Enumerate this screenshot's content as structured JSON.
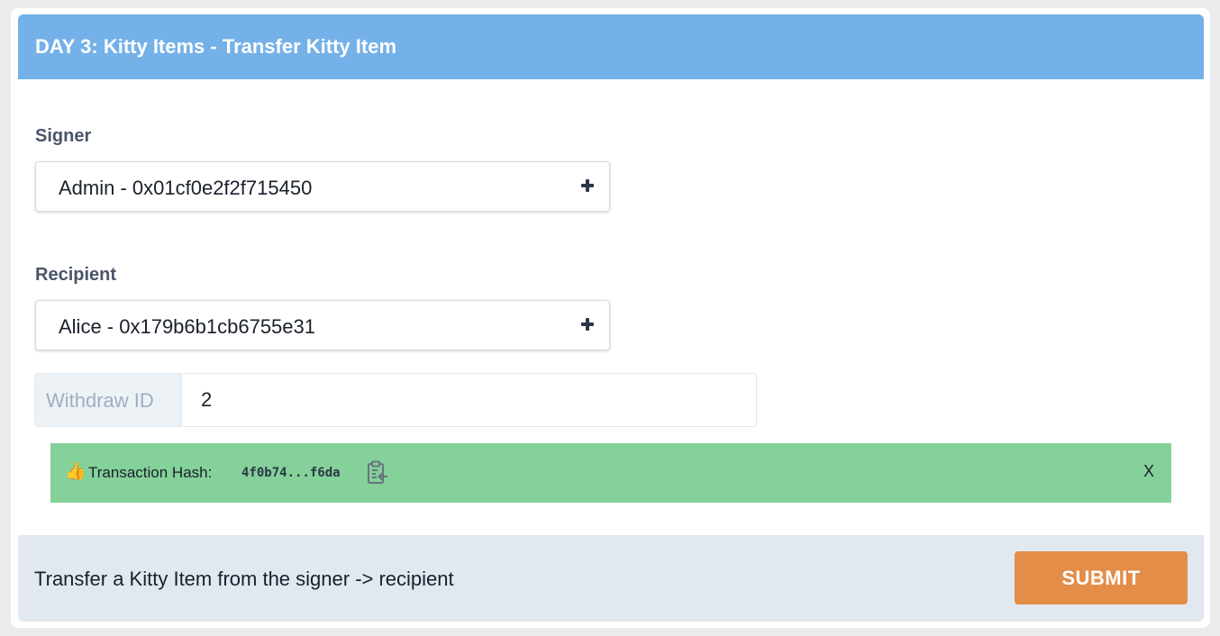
{
  "header": {
    "title": "DAY 3: Kitty Items - Transfer Kitty Item"
  },
  "signer": {
    "label": "Signer",
    "selected": "Admin - 0x01cf0e2f2f715450",
    "icon": "plus-icon"
  },
  "recipient": {
    "label": "Recipient",
    "selected": "Alice - 0x179b6b1cb6755e31",
    "icon": "plus-icon"
  },
  "withdraw": {
    "addon_label": "Withdraw ID",
    "value": "2"
  },
  "alert": {
    "emoji": "👍",
    "label": "Transaction Hash:",
    "hash": "4f0b74...f6da",
    "copy_icon": "clipboard-copy-icon",
    "close_label": "X"
  },
  "footer": {
    "description": "Transfer a Kitty Item from the signer -> recipient",
    "submit_label": "SUBMIT"
  },
  "colors": {
    "header_bg": "#74b1e8",
    "alert_bg": "#84d199",
    "footer_bg": "#e2e8f0",
    "submit_bg": "#e38d48"
  }
}
